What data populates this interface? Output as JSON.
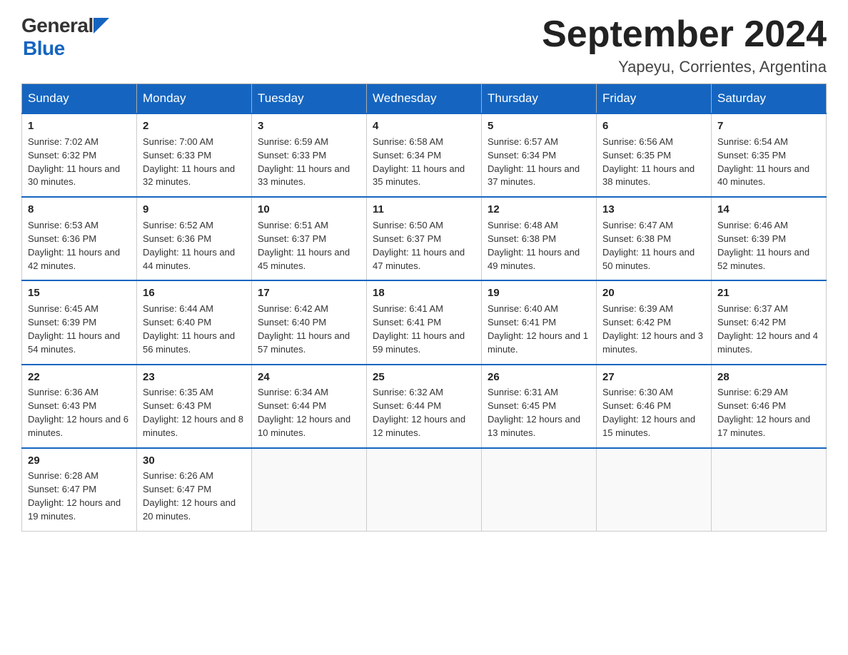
{
  "logo": {
    "general": "General",
    "blue": "Blue"
  },
  "title": "September 2024",
  "subtitle": "Yapeyu, Corrientes, Argentina",
  "headers": [
    "Sunday",
    "Monday",
    "Tuesday",
    "Wednesday",
    "Thursday",
    "Friday",
    "Saturday"
  ],
  "weeks": [
    [
      {
        "day": "1",
        "sunrise": "Sunrise: 7:02 AM",
        "sunset": "Sunset: 6:32 PM",
        "daylight": "Daylight: 11 hours and 30 minutes."
      },
      {
        "day": "2",
        "sunrise": "Sunrise: 7:00 AM",
        "sunset": "Sunset: 6:33 PM",
        "daylight": "Daylight: 11 hours and 32 minutes."
      },
      {
        "day": "3",
        "sunrise": "Sunrise: 6:59 AM",
        "sunset": "Sunset: 6:33 PM",
        "daylight": "Daylight: 11 hours and 33 minutes."
      },
      {
        "day": "4",
        "sunrise": "Sunrise: 6:58 AM",
        "sunset": "Sunset: 6:34 PM",
        "daylight": "Daylight: 11 hours and 35 minutes."
      },
      {
        "day": "5",
        "sunrise": "Sunrise: 6:57 AM",
        "sunset": "Sunset: 6:34 PM",
        "daylight": "Daylight: 11 hours and 37 minutes."
      },
      {
        "day": "6",
        "sunrise": "Sunrise: 6:56 AM",
        "sunset": "Sunset: 6:35 PM",
        "daylight": "Daylight: 11 hours and 38 minutes."
      },
      {
        "day": "7",
        "sunrise": "Sunrise: 6:54 AM",
        "sunset": "Sunset: 6:35 PM",
        "daylight": "Daylight: 11 hours and 40 minutes."
      }
    ],
    [
      {
        "day": "8",
        "sunrise": "Sunrise: 6:53 AM",
        "sunset": "Sunset: 6:36 PM",
        "daylight": "Daylight: 11 hours and 42 minutes."
      },
      {
        "day": "9",
        "sunrise": "Sunrise: 6:52 AM",
        "sunset": "Sunset: 6:36 PM",
        "daylight": "Daylight: 11 hours and 44 minutes."
      },
      {
        "day": "10",
        "sunrise": "Sunrise: 6:51 AM",
        "sunset": "Sunset: 6:37 PM",
        "daylight": "Daylight: 11 hours and 45 minutes."
      },
      {
        "day": "11",
        "sunrise": "Sunrise: 6:50 AM",
        "sunset": "Sunset: 6:37 PM",
        "daylight": "Daylight: 11 hours and 47 minutes."
      },
      {
        "day": "12",
        "sunrise": "Sunrise: 6:48 AM",
        "sunset": "Sunset: 6:38 PM",
        "daylight": "Daylight: 11 hours and 49 minutes."
      },
      {
        "day": "13",
        "sunrise": "Sunrise: 6:47 AM",
        "sunset": "Sunset: 6:38 PM",
        "daylight": "Daylight: 11 hours and 50 minutes."
      },
      {
        "day": "14",
        "sunrise": "Sunrise: 6:46 AM",
        "sunset": "Sunset: 6:39 PM",
        "daylight": "Daylight: 11 hours and 52 minutes."
      }
    ],
    [
      {
        "day": "15",
        "sunrise": "Sunrise: 6:45 AM",
        "sunset": "Sunset: 6:39 PM",
        "daylight": "Daylight: 11 hours and 54 minutes."
      },
      {
        "day": "16",
        "sunrise": "Sunrise: 6:44 AM",
        "sunset": "Sunset: 6:40 PM",
        "daylight": "Daylight: 11 hours and 56 minutes."
      },
      {
        "day": "17",
        "sunrise": "Sunrise: 6:42 AM",
        "sunset": "Sunset: 6:40 PM",
        "daylight": "Daylight: 11 hours and 57 minutes."
      },
      {
        "day": "18",
        "sunrise": "Sunrise: 6:41 AM",
        "sunset": "Sunset: 6:41 PM",
        "daylight": "Daylight: 11 hours and 59 minutes."
      },
      {
        "day": "19",
        "sunrise": "Sunrise: 6:40 AM",
        "sunset": "Sunset: 6:41 PM",
        "daylight": "Daylight: 12 hours and 1 minute."
      },
      {
        "day": "20",
        "sunrise": "Sunrise: 6:39 AM",
        "sunset": "Sunset: 6:42 PM",
        "daylight": "Daylight: 12 hours and 3 minutes."
      },
      {
        "day": "21",
        "sunrise": "Sunrise: 6:37 AM",
        "sunset": "Sunset: 6:42 PM",
        "daylight": "Daylight: 12 hours and 4 minutes."
      }
    ],
    [
      {
        "day": "22",
        "sunrise": "Sunrise: 6:36 AM",
        "sunset": "Sunset: 6:43 PM",
        "daylight": "Daylight: 12 hours and 6 minutes."
      },
      {
        "day": "23",
        "sunrise": "Sunrise: 6:35 AM",
        "sunset": "Sunset: 6:43 PM",
        "daylight": "Daylight: 12 hours and 8 minutes."
      },
      {
        "day": "24",
        "sunrise": "Sunrise: 6:34 AM",
        "sunset": "Sunset: 6:44 PM",
        "daylight": "Daylight: 12 hours and 10 minutes."
      },
      {
        "day": "25",
        "sunrise": "Sunrise: 6:32 AM",
        "sunset": "Sunset: 6:44 PM",
        "daylight": "Daylight: 12 hours and 12 minutes."
      },
      {
        "day": "26",
        "sunrise": "Sunrise: 6:31 AM",
        "sunset": "Sunset: 6:45 PM",
        "daylight": "Daylight: 12 hours and 13 minutes."
      },
      {
        "day": "27",
        "sunrise": "Sunrise: 6:30 AM",
        "sunset": "Sunset: 6:46 PM",
        "daylight": "Daylight: 12 hours and 15 minutes."
      },
      {
        "day": "28",
        "sunrise": "Sunrise: 6:29 AM",
        "sunset": "Sunset: 6:46 PM",
        "daylight": "Daylight: 12 hours and 17 minutes."
      }
    ],
    [
      {
        "day": "29",
        "sunrise": "Sunrise: 6:28 AM",
        "sunset": "Sunset: 6:47 PM",
        "daylight": "Daylight: 12 hours and 19 minutes."
      },
      {
        "day": "30",
        "sunrise": "Sunrise: 6:26 AM",
        "sunset": "Sunset: 6:47 PM",
        "daylight": "Daylight: 12 hours and 20 minutes."
      },
      null,
      null,
      null,
      null,
      null
    ]
  ]
}
